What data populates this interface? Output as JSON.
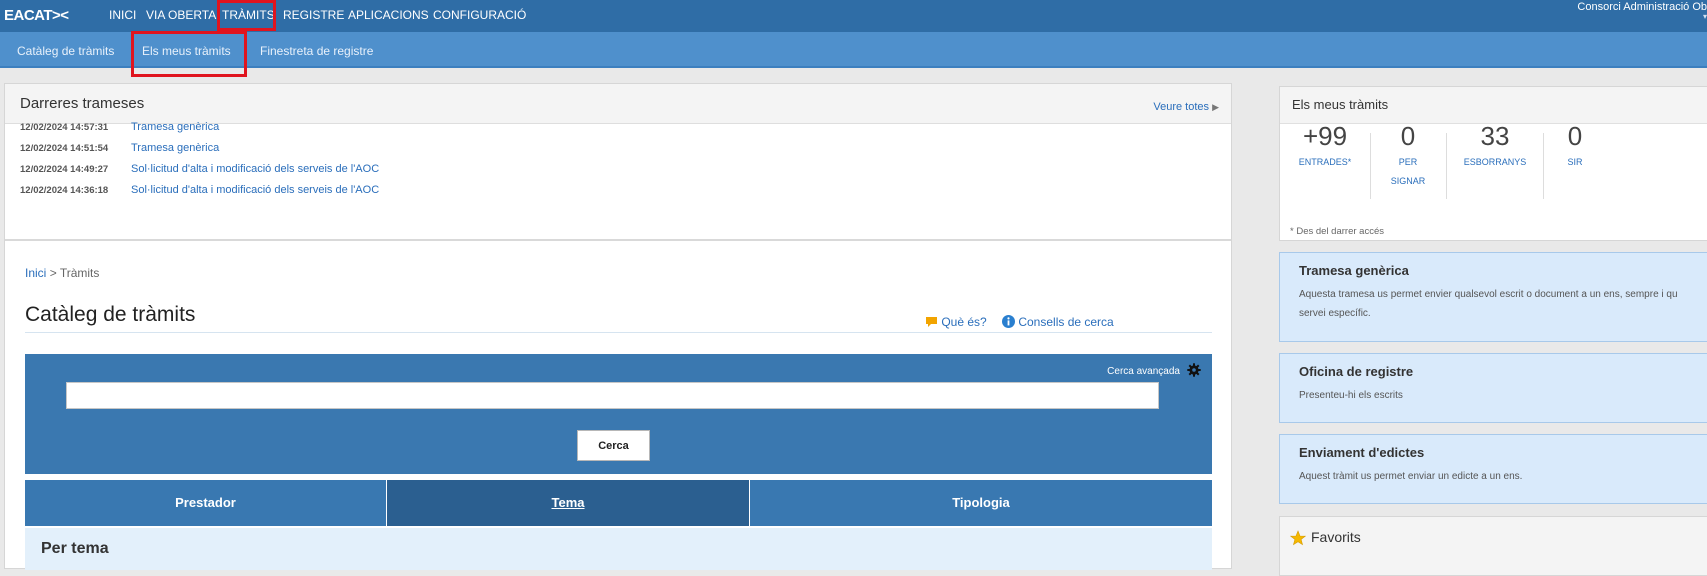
{
  "topnav": {
    "logo": "EACAT><",
    "items": [
      {
        "label": "INICI"
      },
      {
        "label": "VIA OBERTA"
      },
      {
        "label": "TRÀMITS"
      },
      {
        "label": "REGISTRE"
      },
      {
        "label": "APLICACIONS"
      },
      {
        "label": "CONFIGURACIÓ"
      }
    ],
    "active_index": 2,
    "organization": "Consorci Administració Ob"
  },
  "subnav": {
    "items": [
      {
        "label": "Catàleg de tràmits"
      },
      {
        "label": "Els meus tràmits"
      },
      {
        "label": "Finestreta de registre"
      }
    ]
  },
  "recent": {
    "title": "Darreres trameses",
    "see_all": "Veure totes",
    "rows": [
      {
        "date": "12/02/2024 14:57:31",
        "label": "Tramesa genèrica"
      },
      {
        "date": "12/02/2024 14:51:54",
        "label": "Tramesa genèrica"
      },
      {
        "date": "12/02/2024 14:49:27",
        "label": "Sol·licitud d'alta i modificació dels serveis de l'AOC"
      },
      {
        "date": "12/02/2024 14:36:18",
        "label": "Sol·licitud d'alta i modificació dels serveis de l'AOC"
      }
    ]
  },
  "breadcrumb": {
    "home": "Inici",
    "separator": ">",
    "current": "Tràmits"
  },
  "catalog": {
    "title": "Catàleg de tràmits",
    "help_links": {
      "what_is": "Què és?",
      "search_tips": "Consells de cerca"
    },
    "search": {
      "advanced_label": "Cerca avançada",
      "input_value": "",
      "placeholder": "",
      "button_label": "Cerca"
    },
    "tabs": [
      {
        "label": "Prestador",
        "active": false
      },
      {
        "label": "Tema",
        "active": true
      },
      {
        "label": "Tipologia",
        "active": false
      }
    ],
    "section_title": "Per tema"
  },
  "my_procedures": {
    "title": "Els meus tràmits",
    "stats": [
      {
        "value": "+99",
        "label": "ENTRADES*"
      },
      {
        "value": "0",
        "label_line1": "PER",
        "label_line2": "SIGNAR"
      },
      {
        "value": "33",
        "label": "ESBORRANYS"
      },
      {
        "value": "0",
        "label": "SIR"
      }
    ],
    "footnote": "* Des del darrer accés"
  },
  "cards": [
    {
      "title": "Tramesa genèrica",
      "desc_line1": "Aquesta tramesa us permet envier qualsevol escrit o document a un ens, sempre i qu",
      "desc_line2": "servei específic."
    },
    {
      "title": "Oficina de registre",
      "desc_line1": "Presenteu-hi els escrits"
    },
    {
      "title": "Enviament d'edictes",
      "desc_line1": "Aquest tràmit us permet enviar un edicte a un ens."
    }
  ],
  "favorites": {
    "title": "Favorits"
  },
  "colors": {
    "topbar": "#2f6da6",
    "subbar": "#4f90cc",
    "link": "#2a6ebb",
    "highlight": "#e0141e",
    "card_bg": "#d9eafb"
  },
  "icons": {
    "what_is": "speech-bubble-icon",
    "search_tips": "info-icon",
    "advanced": "gear-icon",
    "see_all": "triangle-right-icon",
    "favorites": "star-icon"
  }
}
